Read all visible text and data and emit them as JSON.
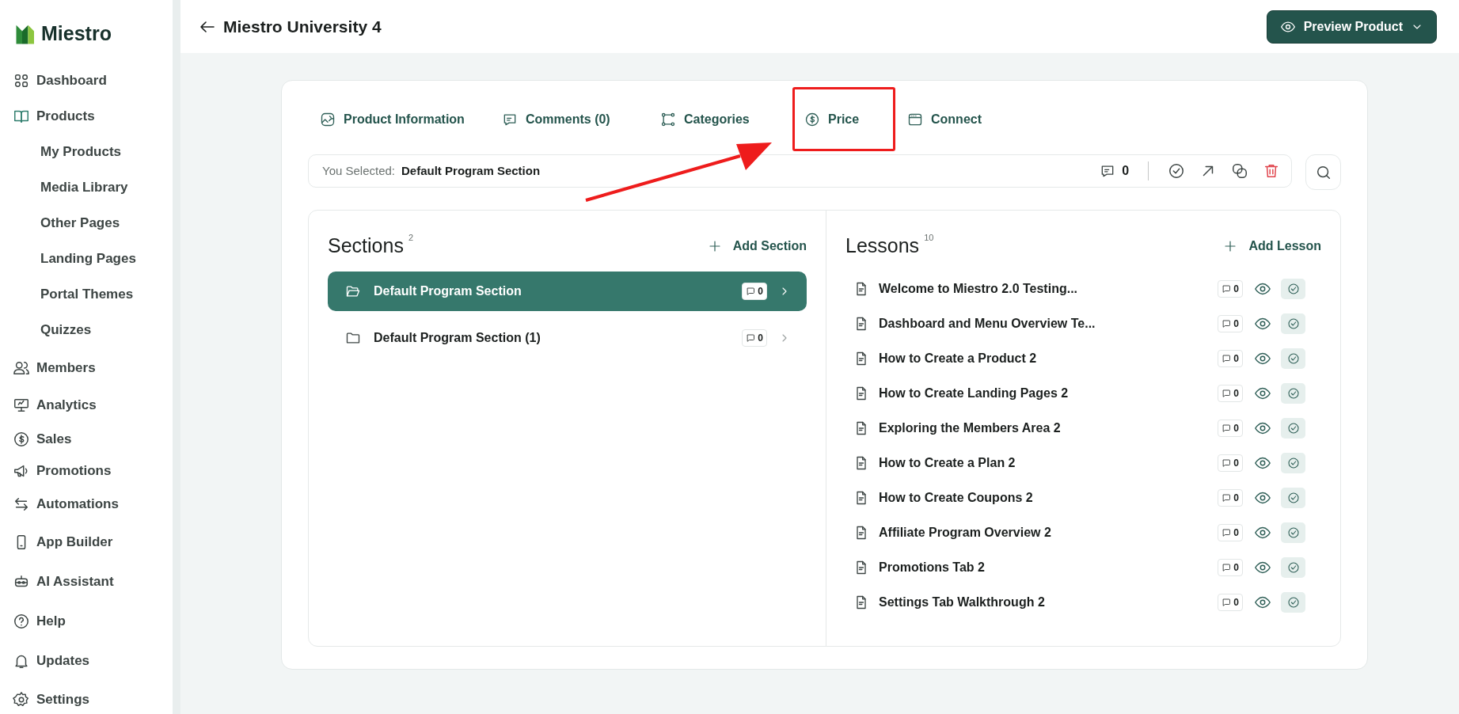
{
  "brand": {
    "name": "Miestro"
  },
  "sidebar": {
    "items": [
      {
        "label": "Dashboard",
        "selected": false
      },
      {
        "label": "Products",
        "selected": true,
        "children": [
          {
            "label": "My Products"
          },
          {
            "label": "Media Library"
          },
          {
            "label": "Other Pages"
          },
          {
            "label": "Landing Pages"
          },
          {
            "label": "Portal Themes"
          },
          {
            "label": "Quizzes"
          }
        ]
      },
      {
        "label": "Members",
        "selected": false
      },
      {
        "label": "Analytics",
        "selected": false
      },
      {
        "label": "Sales",
        "selected": false
      },
      {
        "label": "Promotions",
        "selected": false
      },
      {
        "label": "Automations",
        "selected": false
      },
      {
        "label": "App Builder",
        "selected": false
      },
      {
        "label": "AI Assistant",
        "selected": false
      },
      {
        "label": "Help",
        "selected": false
      },
      {
        "label": "Updates",
        "selected": false
      },
      {
        "label": "Settings",
        "selected": false
      }
    ]
  },
  "header": {
    "title": "Miestro University 4",
    "preview_button": "Preview Product"
  },
  "tabs": [
    {
      "label": "Product Information",
      "selected": false,
      "highlighted": false
    },
    {
      "label": "Comments (0)",
      "selected": false,
      "highlighted": false
    },
    {
      "label": "Categories",
      "selected": false,
      "highlighted": false
    },
    {
      "label": "Price",
      "selected": false,
      "highlighted": true
    },
    {
      "label": "Connect",
      "selected": false,
      "highlighted": false
    }
  ],
  "annotation_arrow": true,
  "selection_bar": {
    "label": "You Selected:",
    "value": "Default Program Section",
    "comments": "0"
  },
  "sections": {
    "title": "Sections",
    "count": "2",
    "add_label": "Add Section",
    "items": [
      {
        "name": "Default Program Section",
        "comments": "0",
        "selected": true
      },
      {
        "name": "Default Program Section (1)",
        "comments": "0",
        "selected": false
      }
    ]
  },
  "lessons": {
    "title": "Lessons",
    "count": "10",
    "add_label": "Add Lesson",
    "items": [
      {
        "name": "Welcome to Miestro 2.0 Testing...",
        "comments": "0"
      },
      {
        "name": "Dashboard and Menu Overview Te...",
        "comments": "0"
      },
      {
        "name": "How to Create a Product 2",
        "comments": "0"
      },
      {
        "name": "How to Create Landing Pages 2",
        "comments": "0"
      },
      {
        "name": "Exploring the Members Area 2",
        "comments": "0"
      },
      {
        "name": "How to Create a Plan 2",
        "comments": "0"
      },
      {
        "name": "How to Create Coupons 2",
        "comments": "0"
      },
      {
        "name": "Affiliate Program Overview 2",
        "comments": "0"
      },
      {
        "name": "Promotions Tab 2",
        "comments": "0"
      },
      {
        "name": "Settings Tab Walkthrough 2",
        "comments": "0"
      }
    ]
  }
}
